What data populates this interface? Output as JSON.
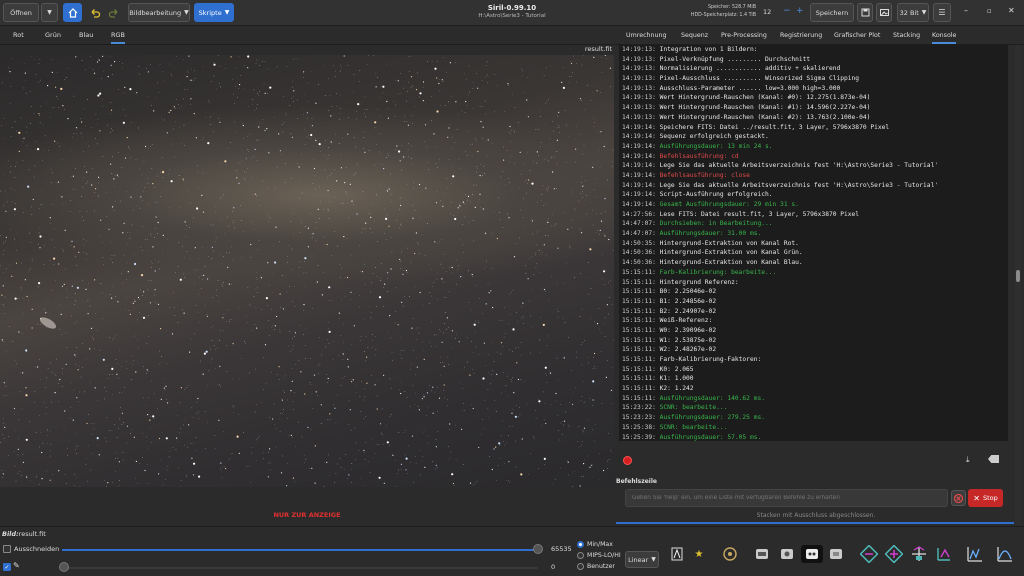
{
  "header": {
    "open_label": "Öffnen",
    "image_processing_label": "Bildbearbeitung",
    "scripts_label": "Skripte",
    "title": "Siril-0.99.10",
    "subtitle": "H:\\Astro\\Serie3 - Tutorial",
    "memory": "Speicher: 528.7 MiB",
    "disk": "HDD-Speicherplatz: 1.4 TiB",
    "threads": "12",
    "save_label": "Speichern",
    "bitdepth": "32 Bit"
  },
  "channel_tabs": [
    "Rot",
    "Grün",
    "Blau",
    "RGB"
  ],
  "viewer": {
    "image_name": "result.fit",
    "notice": "NUR ZUR ANZEIGE"
  },
  "right_tabs": [
    "Umrechnung",
    "Sequenz",
    "Pre-Processing",
    "Registrierung",
    "Grafischer Plot",
    "Stacking",
    "Konsole"
  ],
  "console": [
    {
      "t": "14:19:13:",
      "m": "Integration von 1 Bildern:",
      "c": ""
    },
    {
      "t": "14:19:13:",
      "m": "Pixel-Verknüpfung ......... Durchschnitt",
      "c": ""
    },
    {
      "t": "14:19:13:",
      "m": "Normalisierung ............ additiv + skalierend",
      "c": ""
    },
    {
      "t": "14:19:13:",
      "m": "Pixel-Ausschluss .......... Winsorized Sigma Clipping",
      "c": ""
    },
    {
      "t": "14:19:13:",
      "m": "Ausschluss-Parameter ...... low=3.000 high=3.000",
      "c": ""
    },
    {
      "t": "14:19:13:",
      "m": "Wert Hintergrund-Rauschen (Kanal: #0): 12.275(1.873e-04)",
      "c": ""
    },
    {
      "t": "14:19:13:",
      "m": "Wert Hintergrund-Rauschen (Kanal: #1): 14.596(2.227e-04)",
      "c": ""
    },
    {
      "t": "14:19:13:",
      "m": "Wert Hintergrund-Rauschen (Kanal: #2): 13.763(2.100e-04)",
      "c": ""
    },
    {
      "t": "14:19:14:",
      "m": "Speichere FITS: Datei ../result.fit, 3 Layer, 5796x3870 Pixel",
      "c": ""
    },
    {
      "t": "14:19:14:",
      "m": "Sequenz erfolgreich gestackt.",
      "c": ""
    },
    {
      "t": "14:19:14:",
      "m": "Ausführungsdauer: 13 min 24 s.",
      "c": "green"
    },
    {
      "t": "14:19:14:",
      "m": "Befehlsausführung: cd",
      "c": "red"
    },
    {
      "t": "14:19:14:",
      "m": "Lege Sie das aktuelle Arbeitsverzeichnis fest 'H:\\Astro\\Serie3 - Tutorial'",
      "c": ""
    },
    {
      "t": "14:19:14:",
      "m": "Befehlsausführung: close",
      "c": "red"
    },
    {
      "t": "14:19:14:",
      "m": "Lege Sie das aktuelle Arbeitsverzeichnis fest 'H:\\Astro\\Serie3 - Tutorial'",
      "c": ""
    },
    {
      "t": "14:19:14:",
      "m": "Script-Ausführung erfolgreich.",
      "c": ""
    },
    {
      "t": "14:19:14:",
      "m": "Gesamt Ausführungsdauer: 29 min 31 s.",
      "c": "green"
    },
    {
      "t": "14:27:56:",
      "m": "Lese FITS: Datei result.fit, 3 Layer, 5796x3870 Pixel",
      "c": ""
    },
    {
      "t": "14:47:07:",
      "m": "Durchsieben: in Bearbeitung...",
      "c": "green"
    },
    {
      "t": "14:47:07:",
      "m": "Ausführungsdauer: 31.00 ms.",
      "c": "green"
    },
    {
      "t": "14:50:35:",
      "m": "Hintergrund-Extraktion von Kanal Rot.",
      "c": ""
    },
    {
      "t": "14:50:36:",
      "m": "Hintergrund-Extraktion von Kanal Grün.",
      "c": ""
    },
    {
      "t": "14:50:36:",
      "m": "Hintergrund-Extraktion von Kanal Blau.",
      "c": ""
    },
    {
      "t": "15:15:11:",
      "m": "Farb-Kalibrierung: bearbeite...",
      "c": "green"
    },
    {
      "t": "15:15:11:",
      "m": "Hintergrund Referenz:",
      "c": ""
    },
    {
      "t": "15:15:11:",
      "m": "B0: 2.25046e-02",
      "c": ""
    },
    {
      "t": "15:15:11:",
      "m": "B1: 2.24856e-02",
      "c": ""
    },
    {
      "t": "15:15:11:",
      "m": "B2: 2.24907e-02",
      "c": ""
    },
    {
      "t": "15:15:11:",
      "m": "Weiß-Referenz:",
      "c": ""
    },
    {
      "t": "15:15:11:",
      "m": "W0: 2.39096e-02",
      "c": ""
    },
    {
      "t": "15:15:11:",
      "m": "W1: 2.53875e-02",
      "c": ""
    },
    {
      "t": "15:15:11:",
      "m": "W2: 2.48267e-02",
      "c": ""
    },
    {
      "t": "15:15:11:",
      "m": "Farb-Kalibrierung-Faktoren:",
      "c": ""
    },
    {
      "t": "15:15:11:",
      "m": "K0: 2.065",
      "c": ""
    },
    {
      "t": "15:15:11:",
      "m": "K1: 1.000",
      "c": ""
    },
    {
      "t": "15:15:11:",
      "m": "K2: 1.242",
      "c": ""
    },
    {
      "t": "15:15:11:",
      "m": "Ausführungsdauer: 140.62 ms.",
      "c": "green"
    },
    {
      "t": "15:23:22:",
      "m": "SCNR: bearbeite...",
      "c": "green"
    },
    {
      "t": "15:23:23:",
      "m": "Ausführungsdauer: 279.25 ms.",
      "c": "green"
    },
    {
      "t": "15:25:38:",
      "m": "SCNR: bearbeite...",
      "c": "green"
    },
    {
      "t": "15:25:39:",
      "m": "Ausführungsdauer: 57.05 ms.",
      "c": "green"
    }
  ],
  "command": {
    "label": "Befehlszeile",
    "placeholder": "Geben Sie 'help' ein, um eine Liste mit verfügbaren Befehle zu erhalten",
    "stop_label": "Stop"
  },
  "status": "Stacken mit Ausschluss abgeschlossen.",
  "bottom": {
    "image_label": "Bild:",
    "image_value": "result.fit",
    "crop_label": "Ausschneiden",
    "max_value": "65535",
    "min_value": "0",
    "radio_options": [
      "Min/Max",
      "MIPS-LO/HI",
      "Benutzer"
    ],
    "selected_radio": "Min/Max",
    "scale_mode": "Linear"
  },
  "colors": {
    "accent": "#2f6fcf",
    "stop": "#c62828",
    "log_green": "#38b54a",
    "log_red": "#e04a4a"
  }
}
